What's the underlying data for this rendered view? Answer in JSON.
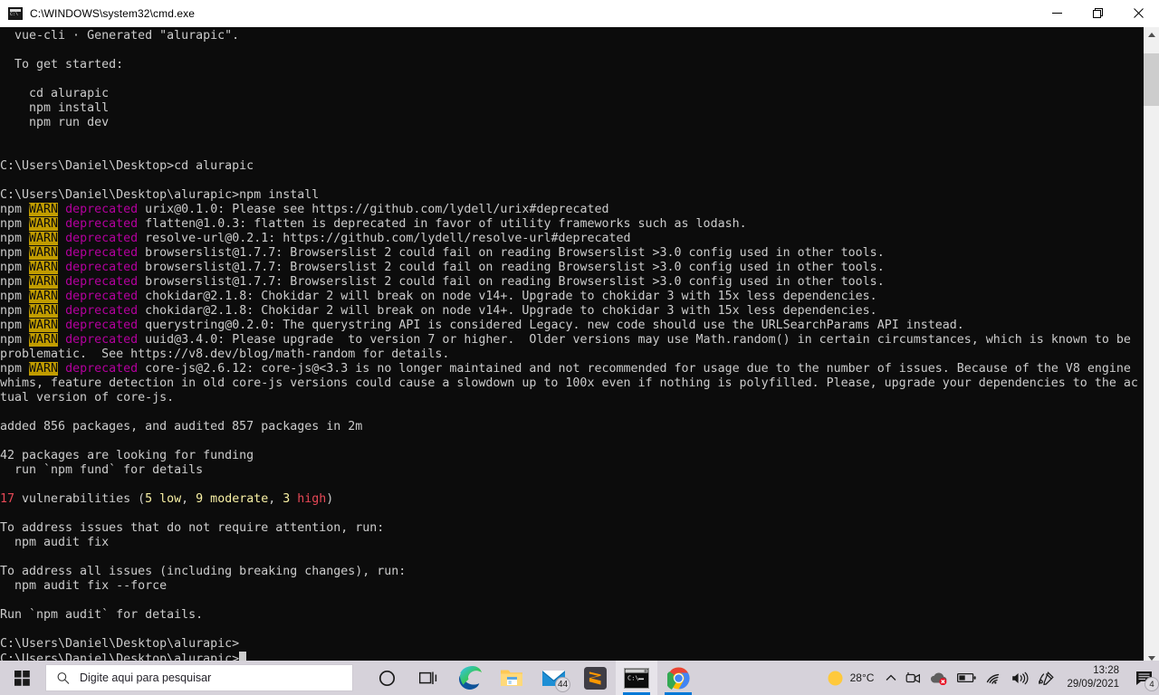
{
  "window": {
    "title": "C:\\WINDOWS\\system32\\cmd.exe",
    "icon": "cmd-icon",
    "controls": {
      "minimize": "minimize-button",
      "maximize": "restore-button",
      "close": "close-button"
    }
  },
  "terminal": {
    "background": "#0c0c0c",
    "foreground": "#cccccc",
    "warn_bg": "#c19c00",
    "magenta": "#b4009e",
    "red": "#e74856",
    "yellow": "#c19c00",
    "cursor": "block-underscore",
    "lines": [
      {
        "segs": [
          {
            "t": "  vue-cli · Generated \"alurapic\".",
            "c": "c-white"
          }
        ]
      },
      {
        "segs": []
      },
      {
        "segs": [
          {
            "t": "  To get started:",
            "c": "c-white"
          }
        ]
      },
      {
        "segs": []
      },
      {
        "segs": [
          {
            "t": "    cd alurapic",
            "c": "c-white"
          }
        ]
      },
      {
        "segs": [
          {
            "t": "    npm install",
            "c": "c-white"
          }
        ]
      },
      {
        "segs": [
          {
            "t": "    npm run dev",
            "c": "c-white"
          }
        ]
      },
      {
        "segs": []
      },
      {
        "segs": []
      },
      {
        "segs": [
          {
            "t": "C:\\Users\\Daniel\\Desktop>cd alurapic",
            "c": "c-white"
          }
        ]
      },
      {
        "segs": []
      },
      {
        "segs": [
          {
            "t": "C:\\Users\\Daniel\\Desktop\\alurapic>npm install",
            "c": "c-white"
          }
        ]
      },
      {
        "segs": [
          {
            "t": "npm ",
            "c": "c-white"
          },
          {
            "t": "WARN",
            "c": "c-warn"
          },
          {
            "t": " ",
            "c": "c-white"
          },
          {
            "t": "deprecated",
            "c": "c-magenta"
          },
          {
            "t": " urix@0.1.0: Please see https://github.com/lydell/urix#deprecated",
            "c": "c-white"
          }
        ]
      },
      {
        "segs": [
          {
            "t": "npm ",
            "c": "c-white"
          },
          {
            "t": "WARN",
            "c": "c-warn"
          },
          {
            "t": " ",
            "c": "c-white"
          },
          {
            "t": "deprecated",
            "c": "c-magenta"
          },
          {
            "t": " flatten@1.0.3: flatten is deprecated in favor of utility frameworks such as lodash.",
            "c": "c-white"
          }
        ]
      },
      {
        "segs": [
          {
            "t": "npm ",
            "c": "c-white"
          },
          {
            "t": "WARN",
            "c": "c-warn"
          },
          {
            "t": " ",
            "c": "c-white"
          },
          {
            "t": "deprecated",
            "c": "c-magenta"
          },
          {
            "t": " resolve-url@0.2.1: https://github.com/lydell/resolve-url#deprecated",
            "c": "c-white"
          }
        ]
      },
      {
        "segs": [
          {
            "t": "npm ",
            "c": "c-white"
          },
          {
            "t": "WARN",
            "c": "c-warn"
          },
          {
            "t": " ",
            "c": "c-white"
          },
          {
            "t": "deprecated",
            "c": "c-magenta"
          },
          {
            "t": " browserslist@1.7.7: Browserslist 2 could fail on reading Browserslist >3.0 config used in other tools.",
            "c": "c-white"
          }
        ]
      },
      {
        "segs": [
          {
            "t": "npm ",
            "c": "c-white"
          },
          {
            "t": "WARN",
            "c": "c-warn"
          },
          {
            "t": " ",
            "c": "c-white"
          },
          {
            "t": "deprecated",
            "c": "c-magenta"
          },
          {
            "t": " browserslist@1.7.7: Browserslist 2 could fail on reading Browserslist >3.0 config used in other tools.",
            "c": "c-white"
          }
        ]
      },
      {
        "segs": [
          {
            "t": "npm ",
            "c": "c-white"
          },
          {
            "t": "WARN",
            "c": "c-warn"
          },
          {
            "t": " ",
            "c": "c-white"
          },
          {
            "t": "deprecated",
            "c": "c-magenta"
          },
          {
            "t": " browserslist@1.7.7: Browserslist 2 could fail on reading Browserslist >3.0 config used in other tools.",
            "c": "c-white"
          }
        ]
      },
      {
        "segs": [
          {
            "t": "npm ",
            "c": "c-white"
          },
          {
            "t": "WARN",
            "c": "c-warn"
          },
          {
            "t": " ",
            "c": "c-white"
          },
          {
            "t": "deprecated",
            "c": "c-magenta"
          },
          {
            "t": " chokidar@2.1.8: Chokidar 2 will break on node v14+. Upgrade to chokidar 3 with 15x less dependencies.",
            "c": "c-white"
          }
        ]
      },
      {
        "segs": [
          {
            "t": "npm ",
            "c": "c-white"
          },
          {
            "t": "WARN",
            "c": "c-warn"
          },
          {
            "t": " ",
            "c": "c-white"
          },
          {
            "t": "deprecated",
            "c": "c-magenta"
          },
          {
            "t": " chokidar@2.1.8: Chokidar 2 will break on node v14+. Upgrade to chokidar 3 with 15x less dependencies.",
            "c": "c-white"
          }
        ]
      },
      {
        "segs": [
          {
            "t": "npm ",
            "c": "c-white"
          },
          {
            "t": "WARN",
            "c": "c-warn"
          },
          {
            "t": " ",
            "c": "c-white"
          },
          {
            "t": "deprecated",
            "c": "c-magenta"
          },
          {
            "t": " querystring@0.2.0: The querystring API is considered Legacy. new code should use the URLSearchParams API instead.",
            "c": "c-white"
          }
        ]
      },
      {
        "segs": [
          {
            "t": "npm ",
            "c": "c-white"
          },
          {
            "t": "WARN",
            "c": "c-warn"
          },
          {
            "t": " ",
            "c": "c-white"
          },
          {
            "t": "deprecated",
            "c": "c-magenta"
          },
          {
            "t": " uuid@3.4.0: Please upgrade  to version 7 or higher.  Older versions may use Math.random() in certain circumstances, which is known to be",
            "c": "c-white"
          }
        ]
      },
      {
        "segs": [
          {
            "t": "problematic.  See https://v8.dev/blog/math-random for details.",
            "c": "c-white"
          }
        ]
      },
      {
        "segs": [
          {
            "t": "npm ",
            "c": "c-white"
          },
          {
            "t": "WARN",
            "c": "c-warn"
          },
          {
            "t": " ",
            "c": "c-white"
          },
          {
            "t": "deprecated",
            "c": "c-magenta"
          },
          {
            "t": " core-js@2.6.12: core-js@<3.3 is no longer maintained and not recommended for usage due to the number of issues. Because of the V8 engine",
            "c": "c-white"
          }
        ]
      },
      {
        "segs": [
          {
            "t": "whims, feature detection in old core-js versions could cause a slowdown up to 100x even if nothing is polyfilled. Please, upgrade your dependencies to the ac",
            "c": "c-white"
          }
        ]
      },
      {
        "segs": [
          {
            "t": "tual version of core-js.",
            "c": "c-white"
          }
        ]
      },
      {
        "segs": []
      },
      {
        "segs": [
          {
            "t": "added 856 packages, and audited 857 packages in 2m",
            "c": "c-white"
          }
        ]
      },
      {
        "segs": []
      },
      {
        "segs": [
          {
            "t": "42 packages are looking for funding",
            "c": "c-white"
          }
        ]
      },
      {
        "segs": [
          {
            "t": "  run `npm fund` for details",
            "c": "c-white"
          }
        ]
      },
      {
        "segs": []
      },
      {
        "segs": [
          {
            "t": "17",
            "c": "c-red"
          },
          {
            "t": " vulnerabilities (",
            "c": "c-white"
          },
          {
            "t": "5 low",
            "c": "c-brightyellow"
          },
          {
            "t": ", ",
            "c": "c-white"
          },
          {
            "t": "9 moderate",
            "c": "c-brightyellow"
          },
          {
            "t": ", ",
            "c": "c-white"
          },
          {
            "t": "3 ",
            "c": "c-brightyellow"
          },
          {
            "t": "high",
            "c": "c-red"
          },
          {
            "t": ")",
            "c": "c-white"
          }
        ]
      },
      {
        "segs": []
      },
      {
        "segs": [
          {
            "t": "To address issues that do not require attention, run:",
            "c": "c-white"
          }
        ]
      },
      {
        "segs": [
          {
            "t": "  npm audit fix",
            "c": "c-white"
          }
        ]
      },
      {
        "segs": []
      },
      {
        "segs": [
          {
            "t": "To address all issues (including breaking changes), run:",
            "c": "c-white"
          }
        ]
      },
      {
        "segs": [
          {
            "t": "  npm audit fix --force",
            "c": "c-white"
          }
        ]
      },
      {
        "segs": []
      },
      {
        "segs": [
          {
            "t": "Run `npm audit` for details.",
            "c": "c-white"
          }
        ]
      },
      {
        "segs": []
      },
      {
        "segs": [
          {
            "t": "C:\\Users\\Daniel\\Desktop\\alurapic>",
            "c": "c-white"
          }
        ]
      },
      {
        "segs": [
          {
            "t": "C:\\Users\\Daniel\\Desktop\\alurapic>",
            "c": "c-white"
          },
          {
            "cursor": true
          }
        ]
      }
    ]
  },
  "scrollbar": {
    "up_arrow": "scroll-up-arrow",
    "down_arrow": "scroll-down-arrow",
    "thumb": "scroll-thumb"
  },
  "taskbar": {
    "start": "start-button",
    "search": {
      "placeholder": "Digite aqui para pesquisar",
      "icon": "search-icon"
    },
    "items": [
      {
        "name": "cortana-button",
        "label": "Cortana"
      },
      {
        "name": "task-view-button",
        "label": "Task View"
      },
      {
        "name": "taskbar-edge",
        "label": "Microsoft Edge"
      },
      {
        "name": "taskbar-file-explorer",
        "label": "File Explorer"
      },
      {
        "name": "taskbar-mail",
        "label": "Mail",
        "badge": "44"
      },
      {
        "name": "taskbar-sublime-text",
        "label": "Sublime Text"
      },
      {
        "name": "taskbar-cmd",
        "label": "cmd.exe",
        "active": true,
        "running": true
      },
      {
        "name": "taskbar-chrome",
        "label": "Google Chrome",
        "running": true
      }
    ],
    "tray": {
      "weather": {
        "temperature": "28°C",
        "icon": "sun-icon"
      },
      "show_hidden": "chevron-up-icon",
      "icons": [
        {
          "name": "webcam-icon"
        },
        {
          "name": "onedrive-error-icon"
        },
        {
          "name": "battery-icon"
        },
        {
          "name": "wifi-icon"
        },
        {
          "name": "volume-icon"
        },
        {
          "name": "pen-workspace-icon"
        }
      ],
      "clock": {
        "time": "13:28",
        "date": "29/09/2021"
      },
      "notifications": {
        "icon": "action-center-icon",
        "badge": "4"
      }
    }
  }
}
